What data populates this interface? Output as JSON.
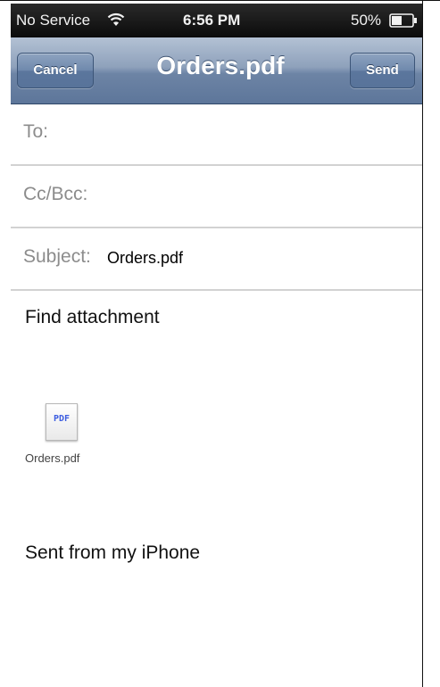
{
  "status_bar": {
    "carrier": "No Service",
    "time": "6:56 PM",
    "battery": "50%",
    "wifi_icon": "wifi-icon",
    "battery_icon": "battery-icon"
  },
  "nav": {
    "title": "Orders.pdf",
    "cancel_label": "Cancel",
    "send_label": "Send"
  },
  "fields": {
    "to_label": "To:",
    "to_value": "",
    "cc_label": "Cc/Bcc:",
    "cc_value": "",
    "subject_label": "Subject:",
    "subject_value": "Orders.pdf"
  },
  "body": {
    "message": "Find attachment",
    "attachment": {
      "icon_text": "PDF",
      "filename": "Orders.pdf"
    },
    "signature": "Sent from my iPhone"
  },
  "colors": {
    "nav_bar": "#6d84a5",
    "status_bar": "#111111",
    "separator": "#d2d2d2",
    "pdf_label": "#3d5de0"
  }
}
